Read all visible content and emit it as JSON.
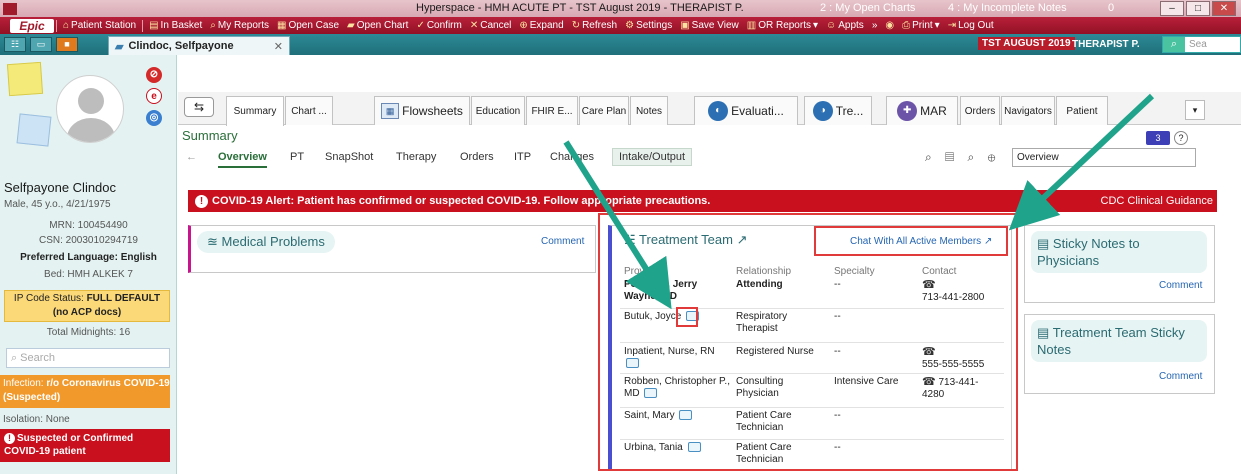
{
  "window": {
    "title": "Hyperspace - HMH ACUTE PT - TST August 2019 - THERAPIST P.",
    "open_charts": "2 : My Open Charts",
    "incomplete_notes": "4 : My Incomplete Notes",
    "messages": "0"
  },
  "menu": {
    "logo": "Epic",
    "items": [
      "Patient Station",
      "In Basket",
      "My Reports",
      "Open Case",
      "Open Chart",
      "Confirm",
      "Cancel",
      "Expand",
      "Refresh",
      "Settings",
      "Save View",
      "OR Reports",
      "Appts",
      "Print",
      "Log Out"
    ]
  },
  "patient_tab": {
    "name": "Clindoc, Selfpayone",
    "env": "TST AUGUST 2019",
    "user": "THERAPIST P.",
    "search_placeholder": "Sea"
  },
  "storyboard": {
    "name": "Selfpayone Clindoc",
    "demographics": "Male, 45 y.o., 4/21/1975",
    "mrn": "MRN: 100454490",
    "csn": "CSN: 2003010294719",
    "language_label": "Preferred Language:",
    "language": "English",
    "bed": "Bed: HMH ALKEK 7",
    "code_status_label": "IP Code Status:",
    "code_status": "FULL DEFAULT (no ACP docs)",
    "midnights": "Total Midnights: 16",
    "search_placeholder": "Search",
    "infection_label": "Infection:",
    "infection": "r/o Coronavirus COVID-19 (Suspected)",
    "isolation": "Isolation: None",
    "covid_flag": "Suspected or Confirmed COVID-19 patient"
  },
  "activity_tabs": [
    "Summary",
    "Chart ...",
    "Flowsheets",
    "Education",
    "FHIR E...",
    "Care Plan",
    "Notes",
    "Evaluati...",
    "Tre...",
    "MAR",
    "Orders",
    "Navigators",
    "Patient"
  ],
  "summary": {
    "title": "Summary",
    "tabs": [
      "Overview",
      "PT",
      "SnapShot",
      "Therapy",
      "Orders",
      "ITP",
      "Changes",
      "Intake/Output"
    ],
    "report": "Overview",
    "badge": "3"
  },
  "alert": {
    "text": "COVID-19 Alert: Patient has confirmed or suspected COVID-19. Follow appropriate precautions.",
    "link": "CDC Clinical Guidance"
  },
  "medical_problems": {
    "title": "Medical Problems",
    "comment": "Comment"
  },
  "treatment_team": {
    "title": "Treatment Team",
    "chat_link": "Chat With All Active Members",
    "columns": [
      "Provider",
      "Relationship",
      "Specialty",
      "Contact"
    ],
    "rows": [
      {
        "provider": "Polansky, Jerry Wayne, MD",
        "relationship": "Attending",
        "specialty": "--",
        "contact": "713-441-2800"
      },
      {
        "provider": "Butuk, Joyce",
        "relationship": "Respiratory Therapist",
        "specialty": "--",
        "contact": ""
      },
      {
        "provider": "Inpatient, Nurse, RN",
        "relationship": "Registered Nurse",
        "specialty": "--",
        "contact": "555-555-5555"
      },
      {
        "provider": "Robben, Christopher P., MD",
        "relationship": "Consulting Physician",
        "specialty": "Intensive Care",
        "contact": "713-441-4280"
      },
      {
        "provider": "Saint, Mary",
        "relationship": "Patient Care Technician",
        "specialty": "--",
        "contact": ""
      },
      {
        "provider": "Urbina, Tania",
        "relationship": "Patient Care Technician",
        "specialty": "--",
        "contact": ""
      }
    ]
  },
  "sticky_physicians": {
    "title": "Sticky Notes to Physicians",
    "comment": "Comment"
  },
  "sticky_team": {
    "title": "Treatment Team Sticky Notes",
    "comment": "Comment"
  }
}
